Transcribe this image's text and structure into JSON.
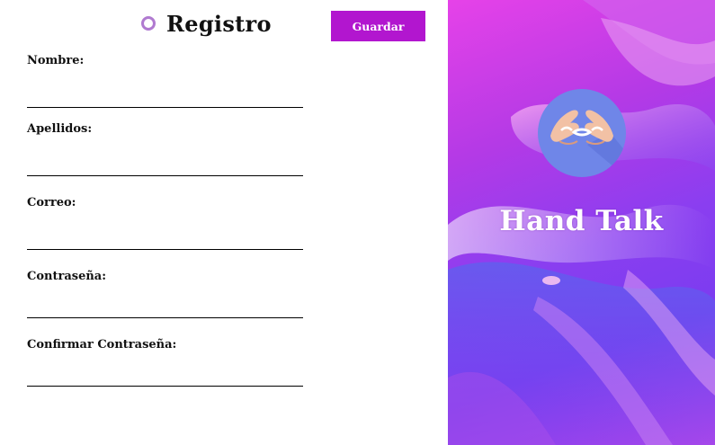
{
  "form": {
    "title": "Registro",
    "save_label": "Guardar",
    "fields": [
      {
        "label": "Nombre:",
        "value": ""
      },
      {
        "label": "Apellidos:",
        "value": ""
      },
      {
        "label": "Correo:",
        "value": ""
      },
      {
        "label": "Contraseña:",
        "value": ""
      },
      {
        "label": "Confirmar Contraseña:",
        "value": ""
      }
    ]
  },
  "brand": {
    "name": "Hand Talk",
    "logo_icon": "sign-language-hands-icon"
  },
  "colors": {
    "accent": "#b216cf",
    "ring": "#b07ad0",
    "logo_bg": "#6f86e8"
  }
}
